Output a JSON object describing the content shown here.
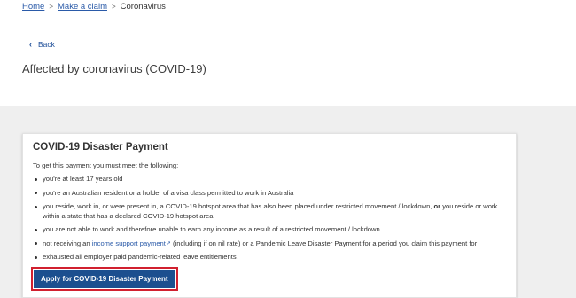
{
  "breadcrumb": {
    "items": [
      {
        "label": "Home"
      },
      {
        "label": "Make a claim"
      },
      {
        "label": "Coronavirus"
      }
    ],
    "separator": ">"
  },
  "back": {
    "label": "Back",
    "icon": "chevron-left-icon"
  },
  "page": {
    "title": "Affected by coronavirus (COVID-19)"
  },
  "card": {
    "title": "COVID-19 Disaster Payment",
    "intro": "To get this payment you must meet the following:",
    "criteria": [
      {
        "text": "you're at least 17 years old"
      },
      {
        "text": "you're an Australian resident or a holder of a visa class permitted to work in Australia"
      },
      {
        "text_a": "you reside, work in, or were present in, a COVID-19 hotspot area that has also been placed under restricted movement / lockdown, ",
        "bold": "or",
        "text_b": " you reside or work within a state that has a declared COVID-19 hotspot area"
      },
      {
        "text": "you are not able to work and therefore unable to earn any income as a result of a restricted movement / lockdown"
      },
      {
        "text_a": "not receiving an ",
        "link": "income support payment",
        "link_icon": "external-link-icon",
        "text_b": " (including if on nil rate) or a Pandemic Leave Disaster Payment for a period you claim this payment for"
      },
      {
        "text": "exhausted all employer paid pandemic-related leave entitlements."
      }
    ],
    "apply_label": "Apply for COVID-19 Disaster Payment"
  },
  "colors": {
    "link": "#2a5aa8",
    "button_bg": "#1c4f8f",
    "highlight_border": "#d1202f",
    "grey_band": "#efefef"
  }
}
